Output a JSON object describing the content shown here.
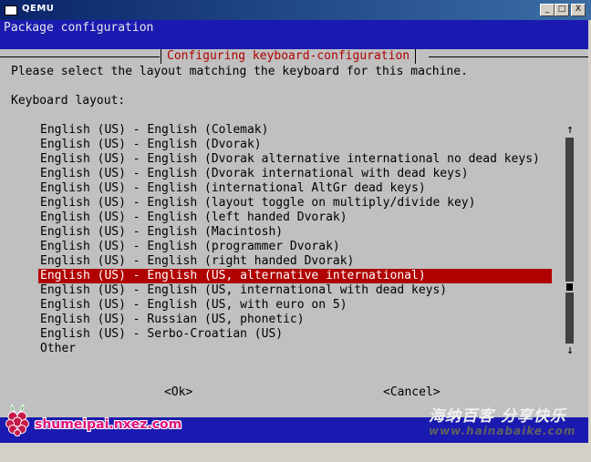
{
  "window": {
    "title": "QEMU",
    "minimize_label": "_",
    "maximize_label": "□",
    "close_label": "X"
  },
  "screen": {
    "package_title": "Package configuration",
    "dialog_title": "Configuring keyboard-configuration",
    "prompt": "Please select the layout matching the keyboard for this machine.",
    "field_label": "Keyboard layout:",
    "items": [
      "English (US) - English (Colemak)",
      "English (US) - English (Dvorak)",
      "English (US) - English (Dvorak alternative international no dead keys)",
      "English (US) - English (Dvorak international with dead keys)",
      "English (US) - English (international AltGr dead keys)",
      "English (US) - English (layout toggle on multiply/divide key)",
      "English (US) - English (left handed Dvorak)",
      "English (US) - English (Macintosh)",
      "English (US) - English (programmer Dvorak)",
      "English (US) - English (right handed Dvorak)",
      "English (US) - English (US, alternative international)",
      "English (US) - English (US, international with dead keys)",
      "English (US) - English (US, with euro on 5)",
      "English (US) - Russian (US, phonetic)",
      "English (US) - Serbo-Croatian (US)",
      "Other"
    ],
    "selected_index": 10,
    "scroll_up_label": "↑",
    "scroll_down_label": "↓",
    "ok_label": "<Ok>",
    "cancel_label": "<Cancel>"
  },
  "watermarks": {
    "left_site": "shumeipai.nxez.com",
    "right_cn": "海纳百客 分享快乐",
    "right_url": "www.hainabaike.com"
  },
  "colors": {
    "tui_background": "#c0c0c0",
    "tui_blue": "#1a1ab0",
    "highlight": "#b00000"
  }
}
